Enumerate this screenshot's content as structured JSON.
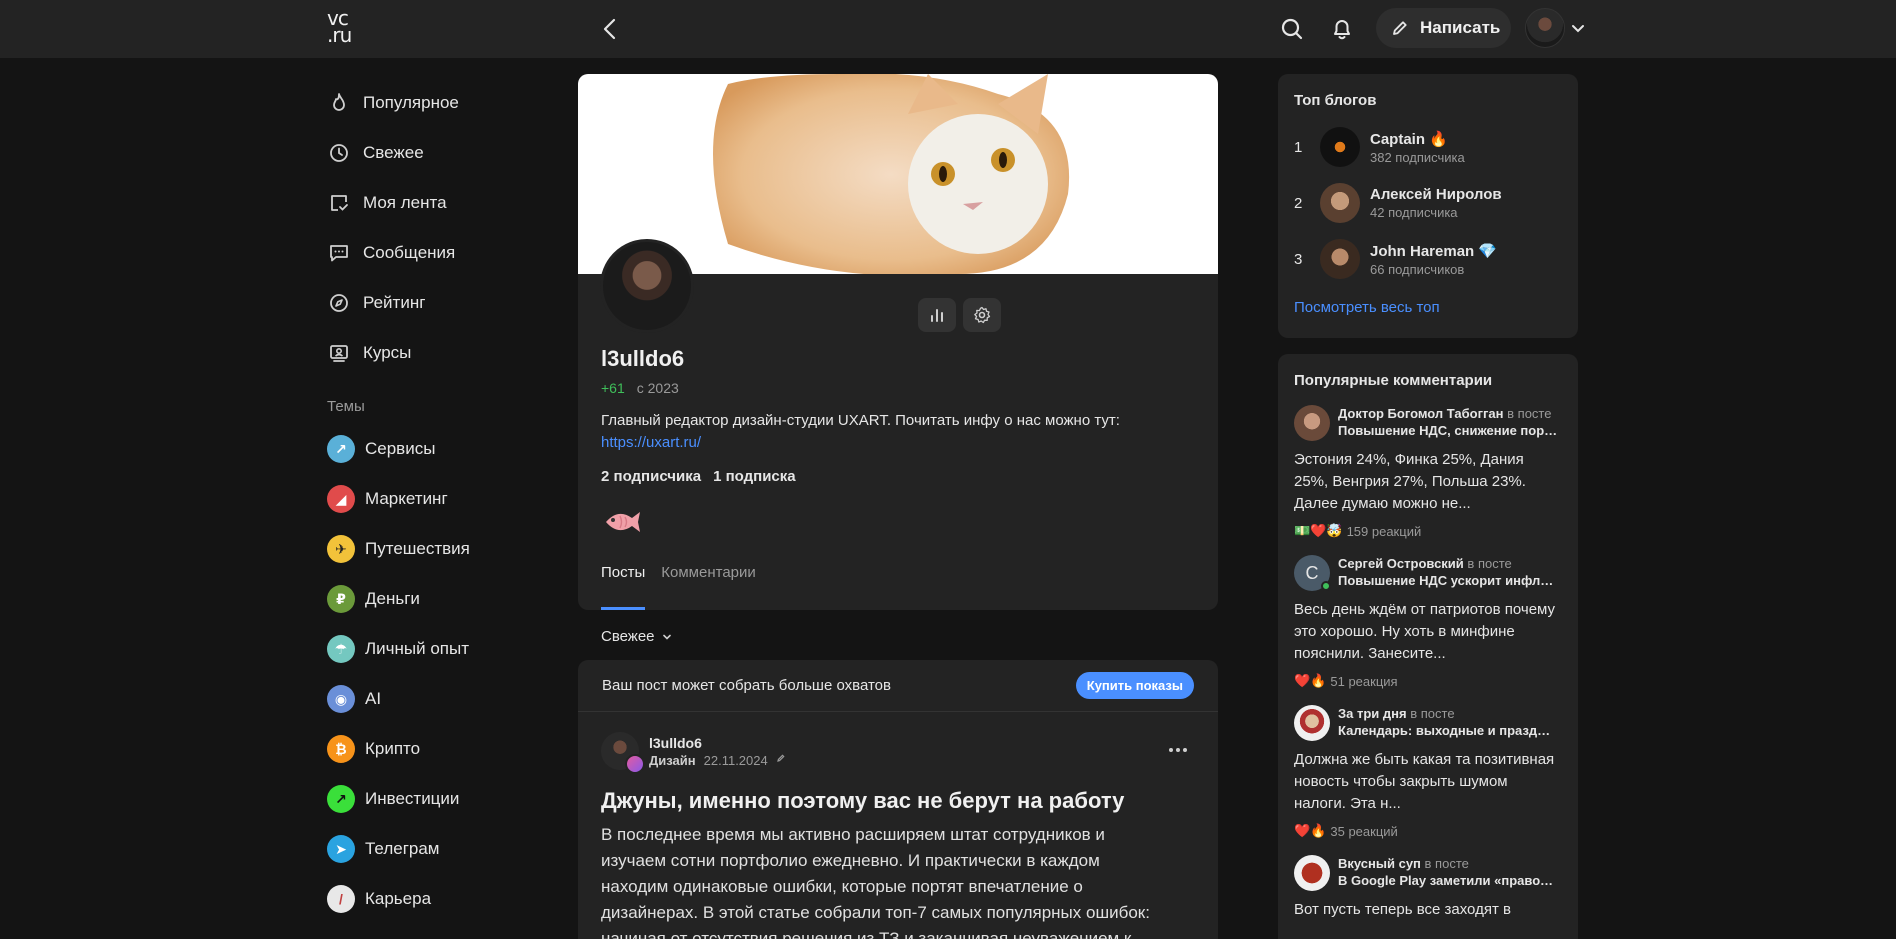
{
  "header": {
    "logo_top": "vc",
    "logo_bottom": ".ru",
    "write_label": "Написать"
  },
  "nav": [
    {
      "label": "Популярное",
      "icon": "flame-icon"
    },
    {
      "label": "Свежее",
      "icon": "clock-icon"
    },
    {
      "label": "Моя лента",
      "icon": "feed-icon"
    },
    {
      "label": "Сообщения",
      "icon": "chat-icon"
    },
    {
      "label": "Рейтинг",
      "icon": "compass-icon"
    },
    {
      "label": "Курсы",
      "icon": "courses-icon"
    }
  ],
  "themes": {
    "title": "Темы",
    "items": [
      {
        "label": "Сервисы",
        "color": "#5ab0d8"
      },
      {
        "label": "Маркетинг",
        "color": "#e04b4b"
      },
      {
        "label": "Путешествия",
        "color": "#3fb8e0"
      },
      {
        "label": "Деньги",
        "color": "#6b9a3a"
      },
      {
        "label": "Личный опыт",
        "color": "#74c8c0"
      },
      {
        "label": "AI",
        "color": "#6a8fd8"
      },
      {
        "label": "Крипто",
        "color": "#f7931a"
      },
      {
        "label": "Инвестиции",
        "color": "#3adf3a"
      },
      {
        "label": "Телеграм",
        "color": "#2aa3e0"
      },
      {
        "label": "Карьера",
        "color": "#e8e8e8"
      }
    ]
  },
  "profile": {
    "name": "l3ulldo6",
    "karma": "+61",
    "since": "с 2023",
    "bio": "Главный редактор дизайн-студии UXART. Почитать инфу о нас можно тут:",
    "link": "https://uxart.ru/",
    "followers": "2 подписчика",
    "following": "1 подписка",
    "tabs": [
      "Посты",
      "Комментарии"
    ]
  },
  "feed": {
    "sort_label": "Свежее",
    "promo_text": "Ваш пост может собрать больше охватов",
    "promo_button": "Купить показы",
    "post": {
      "author": "l3ulldo6",
      "topic": "Дизайн",
      "date": "22.11.2024",
      "title": "Джуны, именно поэтому вас не берут на работу",
      "text": "В последнее время мы активно расширяем штат сотрудников и изучаем сотни портфолио ежедневно. И практически в каждом находим одинаковые ошибки, которые портят впечатление о дизайнерах. В этой статье собрали топ-7 самых популярных ошибок: начиная от отсутствия решения из ТЗ и заканчивая неуважением к"
    }
  },
  "top_blogs": {
    "title": "Топ блогов",
    "items": [
      {
        "rank": "1",
        "name": "Captain 🔥",
        "subs": "382 подписчика"
      },
      {
        "rank": "2",
        "name": "Алексей Ниролов",
        "subs": "42 подписчика"
      },
      {
        "rank": "3",
        "name": "John Hareman 💎",
        "subs": "66 подписчиков"
      }
    ],
    "see_all": "Посмотреть весь топ"
  },
  "popular_comments": {
    "title": "Популярные комментарии",
    "in_post": "в посте",
    "items": [
      {
        "author": "Доктор Богомол Табогган",
        "post": "Повышение НДС, снижение порог...",
        "text": "Эстония 24%, Финка 25%, Дания 25%, Венгрия 27%, Польша 23%. Далее думаю можно не...",
        "emojis": "💵❤️🤯",
        "reactions": "159 реакций"
      },
      {
        "author": "Сергей Островский",
        "post": "Повышение НДС ускорит инфляц...",
        "text": "Весь день ждём от патриотов почему это хорошо. Ну хоть в минфине пояснили. Занесите...",
        "emojis": "❤️🔥",
        "reactions": "51 реакция",
        "initial": "С"
      },
      {
        "author": "За три дня",
        "post": "Календарь: выходные и празднич...",
        "text": "Должна же быть какая та позитивная новость чтобы закрыть шумом налоги. Эта н...",
        "emojis": "❤️🔥",
        "reactions": "35 реакций"
      },
      {
        "author": "Вкусный суп",
        "post": "В Google Play заметили «правосла...",
        "text": "Вот пусть теперь все заходят в",
        "emojis": "",
        "reactions": ""
      }
    ]
  }
}
